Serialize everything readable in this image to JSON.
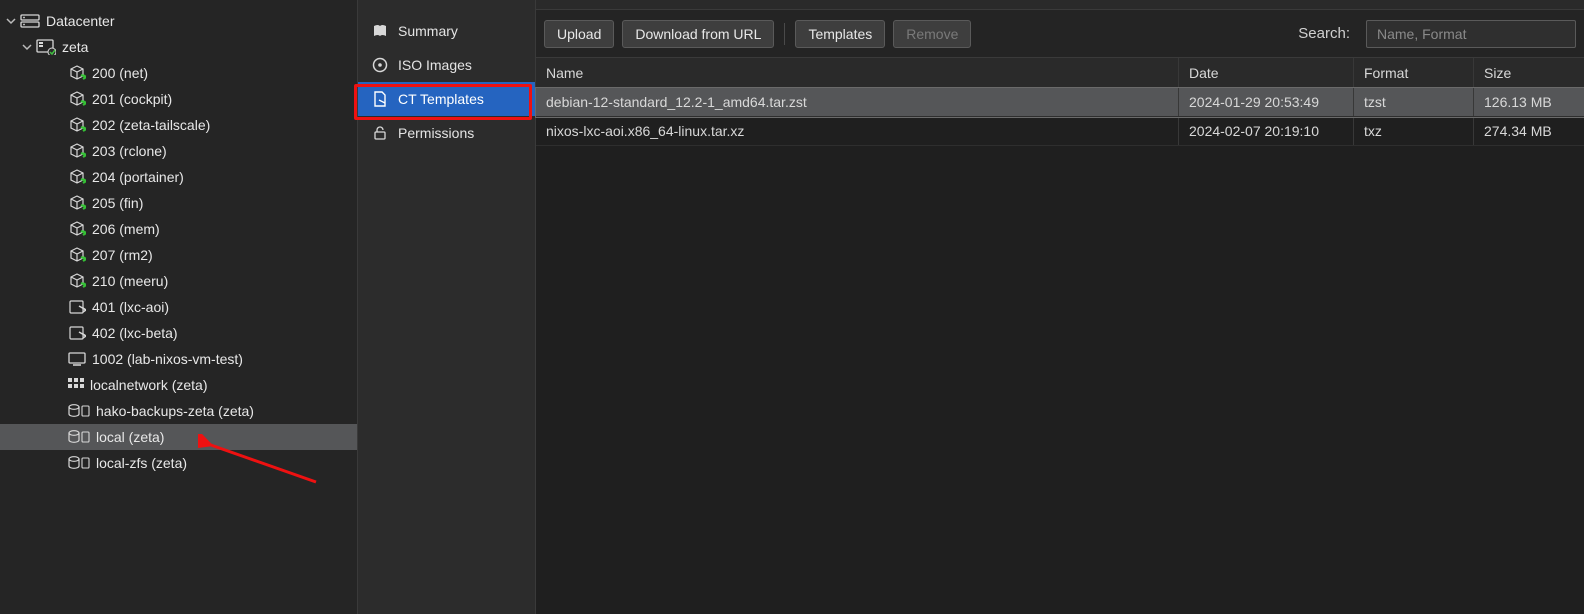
{
  "tree": {
    "root": {
      "label": "Datacenter",
      "icon": "server-icon"
    },
    "node": {
      "label": "zeta",
      "icon": "host-icon"
    },
    "items": [
      {
        "label": "200 (net)",
        "icon": "ct-running-icon"
      },
      {
        "label": "201 (cockpit)",
        "icon": "ct-running-icon"
      },
      {
        "label": "202 (zeta-tailscale)",
        "icon": "ct-running-icon"
      },
      {
        "label": "203 (rclone)",
        "icon": "ct-running-icon"
      },
      {
        "label": "204 (portainer)",
        "icon": "ct-running-icon"
      },
      {
        "label": "205 (fin)",
        "icon": "ct-running-icon"
      },
      {
        "label": "206 (mem)",
        "icon": "ct-running-icon"
      },
      {
        "label": "207 (rm2)",
        "icon": "ct-running-icon"
      },
      {
        "label": "210 (meeru)",
        "icon": "ct-running-icon"
      },
      {
        "label": "401 (lxc-aoi)",
        "icon": "ct-stopped-icon"
      },
      {
        "label": "402 (lxc-beta)",
        "icon": "ct-stopped-icon"
      },
      {
        "label": "1002 (lab-nixos-vm-test)",
        "icon": "vm-icon"
      },
      {
        "label": "localnetwork (zeta)",
        "icon": "network-icon"
      },
      {
        "label": "hako-backups-zeta (zeta)",
        "icon": "storage-icon"
      },
      {
        "label": "local (zeta)",
        "icon": "storage-icon",
        "selected": true
      },
      {
        "label": "local-zfs (zeta)",
        "icon": "storage-icon"
      }
    ]
  },
  "subnav": {
    "items": [
      {
        "label": "Summary",
        "icon": "book-icon"
      },
      {
        "label": "ISO Images",
        "icon": "disc-icon"
      },
      {
        "label": "CT Templates",
        "icon": "file-icon",
        "active": true
      },
      {
        "label": "Permissions",
        "icon": "unlock-icon"
      }
    ]
  },
  "toolbar": {
    "upload_label": "Upload",
    "download_url_label": "Download from URL",
    "templates_label": "Templates",
    "remove_label": "Remove",
    "search_label": "Search:",
    "search_placeholder": "Name, Format"
  },
  "grid": {
    "headers": {
      "name": "Name",
      "date": "Date",
      "format": "Format",
      "size": "Size"
    },
    "rows": [
      {
        "name": "debian-12-standard_12.2-1_amd64.tar.zst",
        "date": "2024-01-29 20:53:49",
        "format": "tzst",
        "size": "126.13 MB",
        "selected": true
      },
      {
        "name": "nixos-lxc-aoi.x86_64-linux.tar.xz",
        "date": "2024-02-07 20:19:10",
        "format": "txz",
        "size": "274.34 MB",
        "selected": false
      }
    ]
  }
}
